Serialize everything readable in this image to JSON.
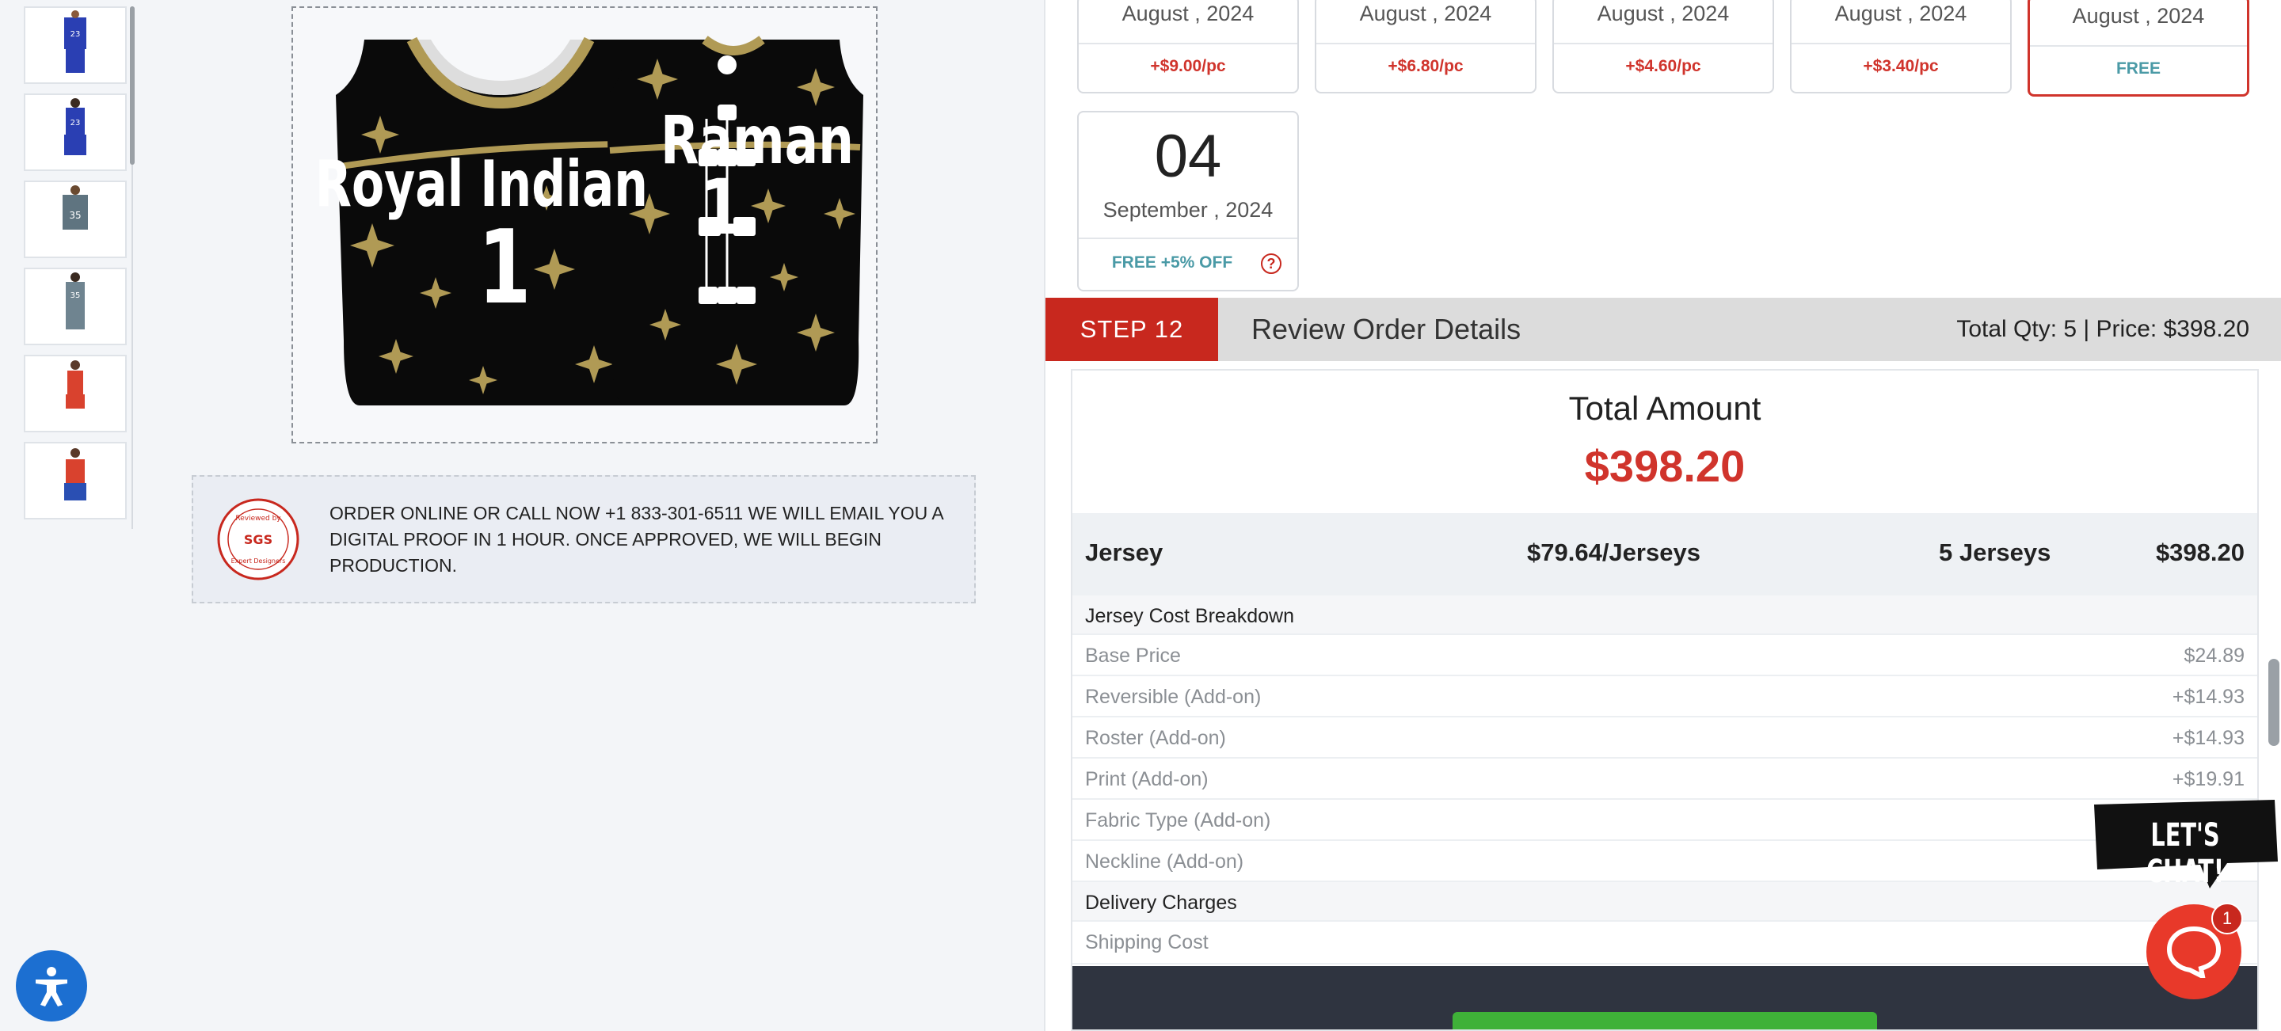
{
  "thumbnails": [
    {
      "icon": "jersey-blue-23",
      "alt": "Blue 23 jersey front"
    },
    {
      "icon": "jersey-blue-23-full",
      "alt": "Blue 23 uniform"
    },
    {
      "icon": "jersey-gray-35",
      "alt": "Gray 35 jersey"
    },
    {
      "icon": "jersey-gray-35-full",
      "alt": "Gray 35 uniform"
    },
    {
      "icon": "jersey-red-women",
      "alt": "Red women uniform"
    },
    {
      "icon": "jersey-red-women-2",
      "alt": "Red women uniform 2"
    }
  ],
  "design": {
    "front_text": "Royal Indian",
    "front_number": "1",
    "back_name": "Raman",
    "back_number": "1"
  },
  "notice": {
    "text": "ORDER ONLINE OR CALL NOW +1 833-301-6511 WE WILL EMAIL YOU A DIGITAL PROOF IN 1 HOUR. ONCE APPROVED, WE WILL BEGIN PRODUCTION.",
    "seal_top": "Reviewed by",
    "seal_mid": "SGS",
    "seal_bottom": "Expert Designers"
  },
  "delivery_dates": [
    {
      "month": "August , 2024",
      "price": "+$9.00/pc"
    },
    {
      "month": "August , 2024",
      "price": "+$6.80/pc"
    },
    {
      "month": "August , 2024",
      "price": "+$4.60/pc"
    },
    {
      "month": "August , 2024",
      "price": "+$3.40/pc"
    },
    {
      "month": "August , 2024",
      "price": "FREE"
    }
  ],
  "extra_date": {
    "day": "04",
    "month": "September , 2024",
    "price": "FREE +5% OFF",
    "help": "?"
  },
  "step": {
    "badge": "STEP 12",
    "title": "Review Order Details",
    "summary": "Total Qty: 5 | Price: $398.20"
  },
  "review": {
    "total_label": "Total Amount",
    "total_value": "$398.20",
    "jersey": {
      "name": "Jersey",
      "unit_price": "$79.64/Jerseys",
      "qty": "5 Jerseys",
      "total": "$398.20"
    },
    "breakdown_title": "Jersey Cost Breakdown",
    "breakdown": [
      {
        "label": "Base Price",
        "value": "$24.89"
      },
      {
        "label": "Reversible (Add-on)",
        "value": "+$14.93"
      },
      {
        "label": "Roster (Add-on)",
        "value": "+$14.93"
      },
      {
        "label": "Print (Add-on)",
        "value": "+$19.91"
      },
      {
        "label": "Fabric Type (Add-on)",
        "value": ""
      },
      {
        "label": "Neckline (Add-on)",
        "value": ""
      }
    ],
    "delivery_title": "Delivery Charges",
    "shipping_label": "Shipping Cost"
  },
  "chat": {
    "bubble": "LET'S CHAT!",
    "badge": "1"
  },
  "colors": {
    "accent_red": "#c8281e",
    "free_teal": "#4a9aa6",
    "gold": "#b09a55"
  }
}
